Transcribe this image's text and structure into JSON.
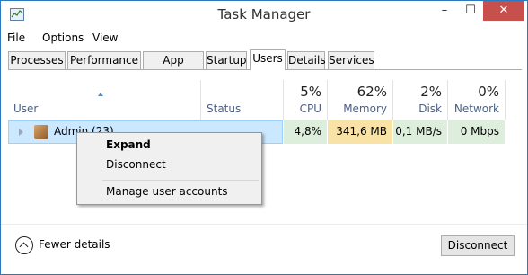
{
  "window": {
    "title": "Task Manager",
    "min": "–",
    "max": "☐",
    "close": "✕"
  },
  "menu": [
    "File",
    "Options",
    "View"
  ],
  "tabs": [
    "Processes",
    "Performance",
    "App history",
    "Startup",
    "Users",
    "Details",
    "Services"
  ],
  "active_tab": "Users",
  "columns": {
    "user": "User",
    "status": "Status",
    "cpu": {
      "pct": "5%",
      "label": "CPU"
    },
    "memory": {
      "pct": "62%",
      "label": "Memory"
    },
    "disk": {
      "pct": "2%",
      "label": "Disk"
    },
    "network": {
      "pct": "0%",
      "label": "Network"
    }
  },
  "rows": [
    {
      "user": "Admin (23)",
      "status": "",
      "cpu": "4,8%",
      "memory": "341,6 MB",
      "disk": "0,1 MB/s",
      "network": "0 Mbps"
    }
  ],
  "context_menu": {
    "expand": "Expand",
    "disconnect": "Disconnect",
    "manage": "Manage user accounts"
  },
  "footer": {
    "fewer_details": "Fewer details",
    "disconnect_button": "Disconnect"
  },
  "colors": {
    "selection": "#cce8ff",
    "cpu_heat": "#ddeedd",
    "mem_heat": "#f8e2a5",
    "close_button": "#c7504c"
  }
}
